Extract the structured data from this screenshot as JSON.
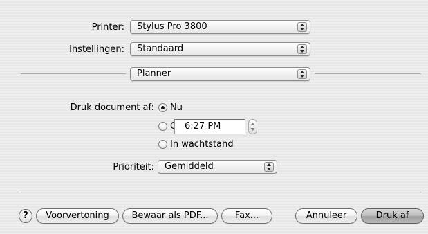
{
  "printer": {
    "label": "Printer:",
    "value": "Stylus Pro 3800"
  },
  "settings": {
    "label": "Instellingen:",
    "value": "Standaard"
  },
  "panel": {
    "value": "Planner"
  },
  "schedule": {
    "label": "Druk document af:",
    "options": [
      {
        "label": "Nu",
        "selected": true
      },
      {
        "label": "Om",
        "selected": false
      },
      {
        "label": "In wachtstand",
        "selected": false
      }
    ],
    "time": "6:27 PM"
  },
  "priority": {
    "label": "Prioriteit:",
    "value": "Gemiddeld"
  },
  "buttons": {
    "help": "?",
    "preview": "Voorvertoning",
    "save_pdf": "Bewaar als PDF...",
    "fax": "Fax...",
    "cancel": "Annuleer",
    "print": "Druk af"
  },
  "icons": {
    "popup_arrows": "up-down-arrows-icon",
    "stepper": "stepper-arrows-icon",
    "help": "help-icon"
  }
}
